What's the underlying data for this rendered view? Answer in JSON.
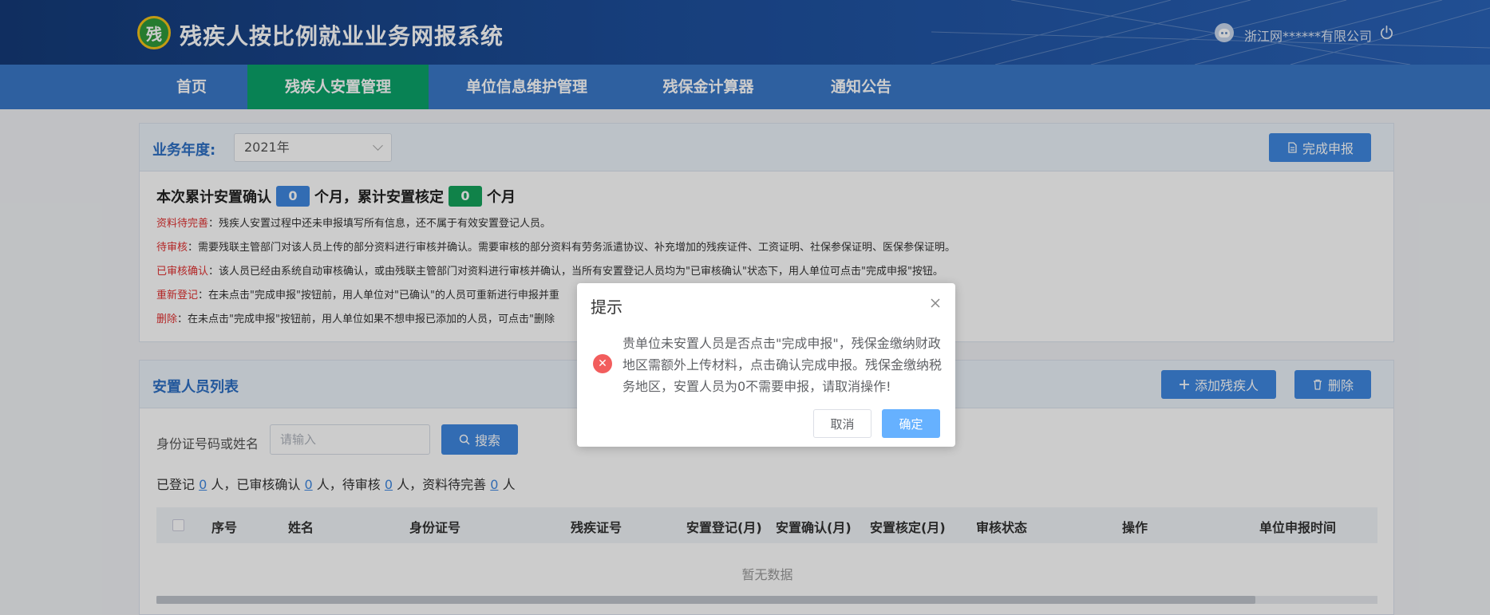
{
  "header": {
    "logo_text": "残",
    "title": "残疾人按比例就业业务网报系统",
    "user_name": "浙江网******有限公司"
  },
  "nav": {
    "items": [
      {
        "label": "首页"
      },
      {
        "label": "残疾人安置管理",
        "active": true
      },
      {
        "label": "单位信息维护管理"
      },
      {
        "label": "残保金计算器"
      },
      {
        "label": "通知公告"
      }
    ]
  },
  "top_panel": {
    "year_label": "业务年度:",
    "year_value": "2021年",
    "complete_button": "完成申报",
    "summary": {
      "prefix": "本次累计安置确认",
      "confirm_count": "0",
      "middle": "个月，累计安置核定",
      "verify_count": "0",
      "suffix": "个月"
    },
    "notes": [
      {
        "tag": "资料待完善",
        "text": "：残疾人安置过程中还未申报填写所有信息，还不属于有效安置登记人员。"
      },
      {
        "tag": "待审核",
        "text": "：需要残联主管部门对该人员上传的部分资料进行审核并确认。需要审核的部分资料有劳务派遣协议、补充增加的残疾证件、工资证明、社保参保证明、医保参保证明。"
      },
      {
        "tag": "已审核确认",
        "text": "：该人员已经由系统自动审核确认，或由残联主管部门对资料进行审核并确认，当所有安置登记人员均为\"已审核确认\"状态下，用人单位可点击\"完成申报\"按钮。"
      },
      {
        "tag": "重新登记",
        "text": "：在未点击\"完成申报\"按钮前，用人单位对\"已确认\"的人员可重新进行申报并重"
      },
      {
        "tag": "删除",
        "text": "：在未点击\"完成申报\"按钮前，用人单位如果不想申报已添加的人员，可点击\"删除"
      }
    ]
  },
  "list_panel": {
    "title": "安置人员列表",
    "add_button": "添加残疾人",
    "delete_button": "删除",
    "search_label": "身份证号码或姓名",
    "search_placeholder": "请输入",
    "search_button": "搜索",
    "counts": {
      "t1": "已登记",
      "n1": "0",
      "t2": "人，已审核确认",
      "n2": "0",
      "t3": "人，待审核",
      "n3": "0",
      "t4": "人，资料待完善",
      "n4": "0",
      "t5": "人"
    },
    "columns": [
      "序号",
      "姓名",
      "身份证号",
      "残疾证号",
      "安置登记(月)",
      "安置确认(月)",
      "安置核定(月)",
      "审核状态",
      "操作",
      "单位申报时间"
    ],
    "empty_text": "暂无数据"
  },
  "dialog": {
    "title": "提示",
    "message": "贵单位未安置人员是否点击\"完成申报\"，残保金缴纳财政地区需额外上传材料，点击确认完成申报。残保金缴纳税务地区，安置人员为0不需要申报，请取消操作!",
    "cancel": "取消",
    "confirm": "确定"
  },
  "icons": [
    "logo-icon",
    "user-avatar-icon",
    "power-icon",
    "document-icon",
    "plus-icon",
    "trash-icon",
    "search-icon",
    "close-icon",
    "error-icon"
  ],
  "colors": {
    "nav_active": "#0aa36a",
    "primary": "#3f88e0",
    "error": "#f25d5d",
    "note_tag": "#e03030"
  }
}
